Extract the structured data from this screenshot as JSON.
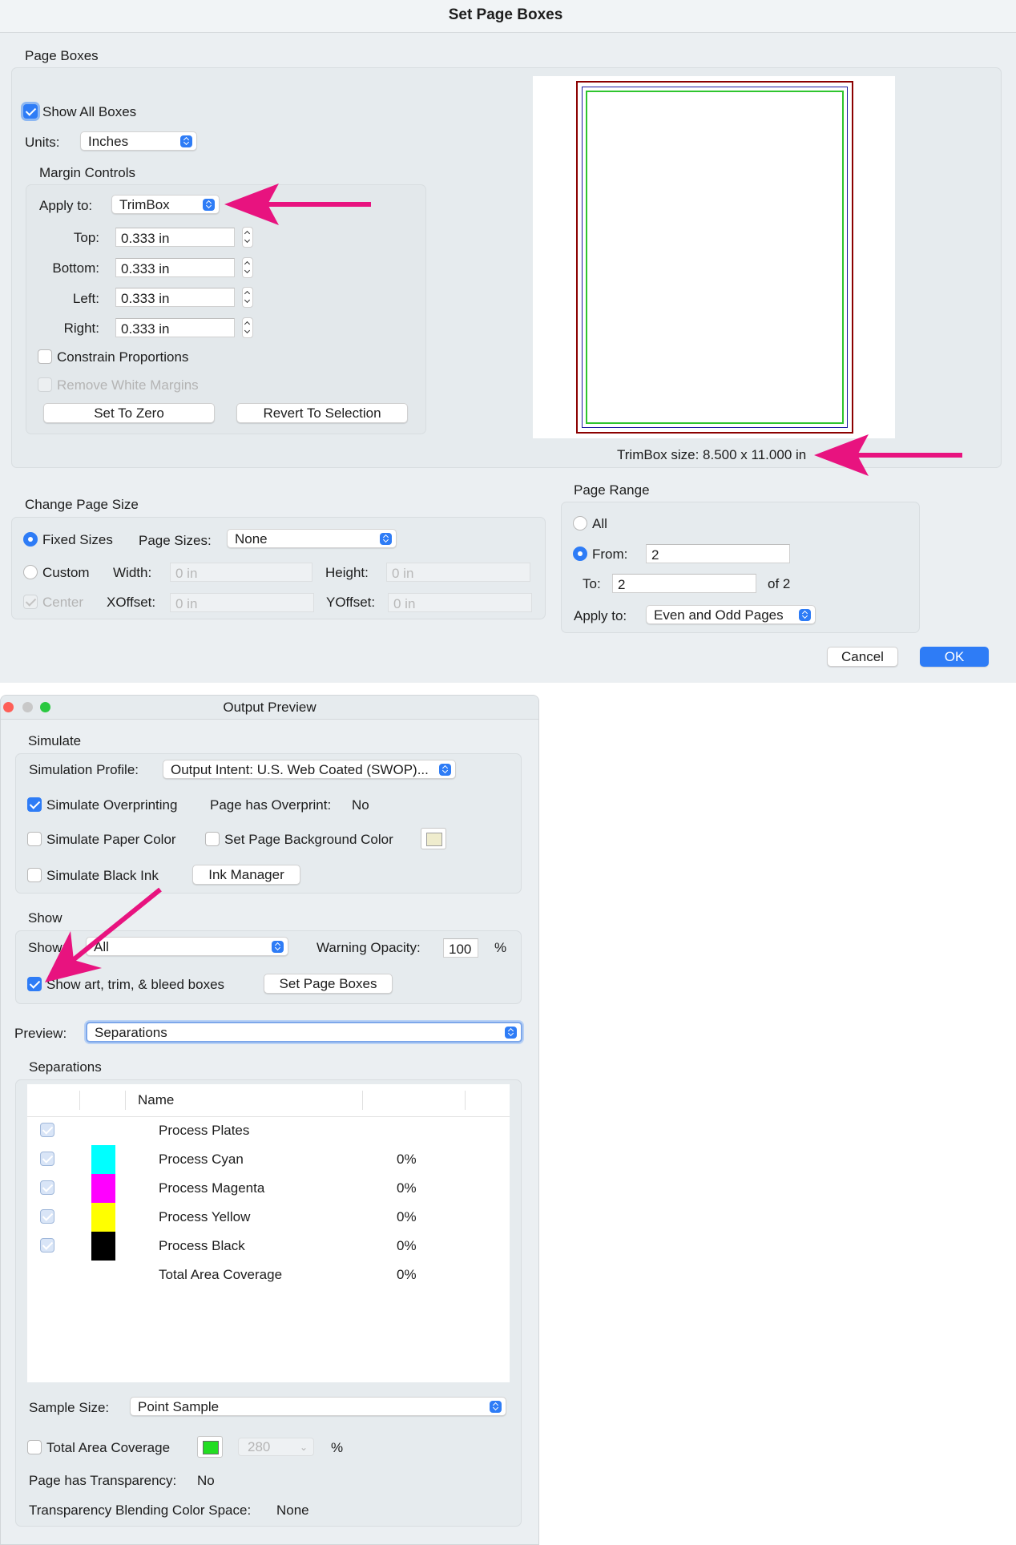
{
  "set_page_boxes": {
    "title": "Set Page Boxes",
    "page_boxes_label": "Page Boxes",
    "show_all_boxes": "Show All Boxes",
    "units_label": "Units:",
    "units_value": "Inches",
    "margin_controls_label": "Margin Controls",
    "apply_to_label": "Apply to:",
    "apply_to_value": "TrimBox",
    "top_label": "Top:",
    "top_value": "0.333 in",
    "bottom_label": "Bottom:",
    "bottom_value": "0.333 in",
    "left_label": "Left:",
    "left_value": "0.333 in",
    "right_label": "Right:",
    "right_value": "0.333 in",
    "constrain_proportions": "Constrain Proportions",
    "remove_white_margins": "Remove White Margins",
    "set_to_zero": "Set To Zero",
    "revert_to_selection": "Revert To Selection",
    "trimbox_size": "TrimBox size: 8.500 x 11.000 in",
    "change_page_size_label": "Change Page Size",
    "fixed_sizes": "Fixed Sizes",
    "page_sizes_label": "Page Sizes:",
    "page_sizes_value": "None",
    "custom": "Custom",
    "width_label": "Width:",
    "width_value": "0 in",
    "height_label": "Height:",
    "height_value": "0 in",
    "center": "Center",
    "xoffset_label": "XOffset:",
    "xoffset_value": "0 in",
    "yoffset_label": "YOffset:",
    "yoffset_value": "0 in",
    "page_range_label": "Page Range",
    "all": "All",
    "from_label": "From:",
    "from_value": "2",
    "to_label": "To:",
    "to_value": "2",
    "of_label": "of 2",
    "range_apply_to_label": "Apply to:",
    "range_apply_to_value": "Even and Odd Pages",
    "cancel": "Cancel",
    "ok": "OK"
  },
  "output_preview": {
    "title": "Output Preview",
    "simulate_label": "Simulate",
    "simulation_profile_label": "Simulation Profile:",
    "simulation_profile_value": "Output Intent: U.S. Web Coated (SWOP)...",
    "simulate_overprinting": "Simulate Overprinting",
    "page_has_overprint_label": "Page has Overprint:",
    "page_has_overprint_value": "No",
    "simulate_paper_color": "Simulate Paper Color",
    "set_page_background_color": "Set Page Background Color",
    "simulate_black_ink": "Simulate Black Ink",
    "ink_manager": "Ink Manager",
    "show_label": "Show",
    "show_select_label": "Show:",
    "show_select_value": "All",
    "warning_opacity_label": "Warning Opacity:",
    "warning_opacity_value": "100",
    "percent": "%",
    "show_boxes": "Show art, trim, & bleed boxes",
    "set_page_boxes_button": "Set Page Boxes",
    "preview_label": "Preview:",
    "preview_value": "Separations",
    "separations_label": "Separations",
    "table_header_name": "Name",
    "rows": [
      {
        "name": "Process Plates",
        "value": "",
        "color": ""
      },
      {
        "name": "Process Cyan",
        "value": "0%",
        "color": "#00ffff"
      },
      {
        "name": "Process Magenta",
        "value": "0%",
        "color": "#ff00ff"
      },
      {
        "name": "Process Yellow",
        "value": "0%",
        "color": "#ffff00"
      },
      {
        "name": "Process Black",
        "value": "0%",
        "color": "#000000"
      },
      {
        "name": "Total Area Coverage",
        "value": "0%",
        "color": ""
      }
    ],
    "sample_size_label": "Sample Size:",
    "sample_size_value": "Point Sample",
    "total_area_coverage": "Total Area Coverage",
    "tac_value": "280",
    "tac_percent": "%",
    "page_has_transparency_label": "Page has Transparency:",
    "page_has_transparency_value": "No",
    "blending_space_label": "Transparency Blending Color Space:",
    "blending_space_value": "None"
  },
  "colors": {
    "accent": "#2e7cf6",
    "annotation_arrow": "#e8137f",
    "mediabox": "#8b0000",
    "cropbox": "#1a1aa0",
    "trimbox": "#2ec52e"
  }
}
